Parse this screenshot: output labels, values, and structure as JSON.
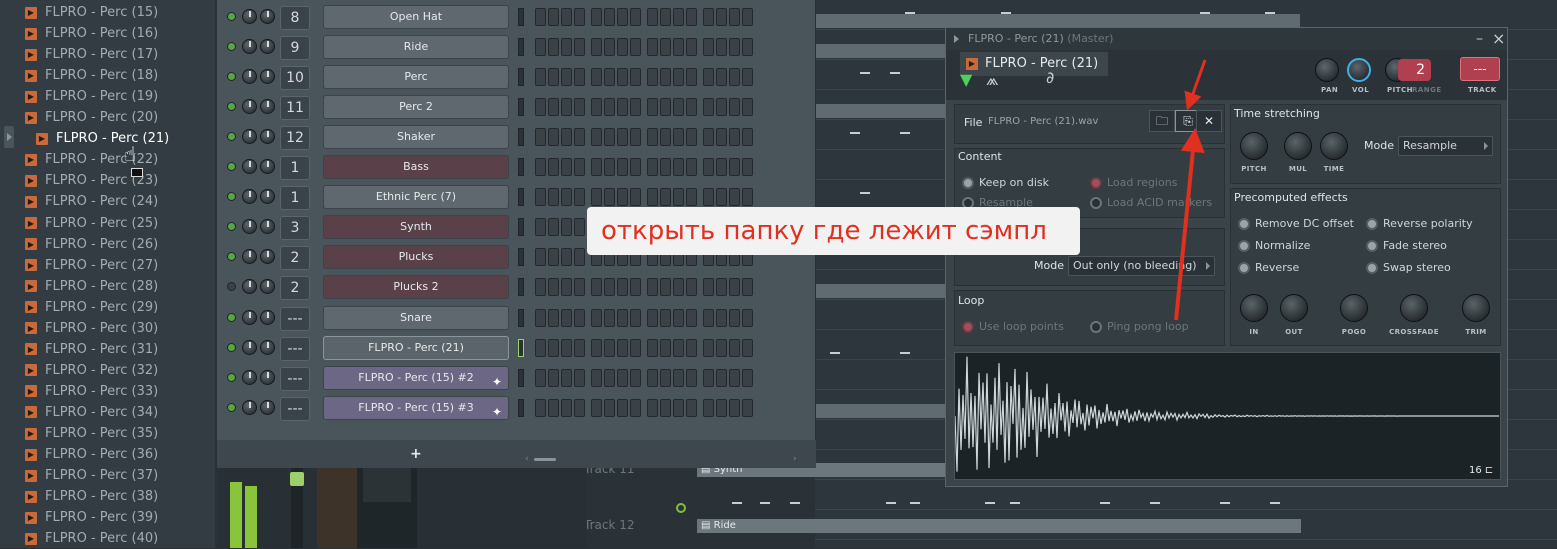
{
  "browser": {
    "items": [
      "FLPRO - Perc (15)",
      "FLPRO - Perc (16)",
      "FLPRO - Perc (17)",
      "FLPRO - Perc (18)",
      "FLPRO - Perc (19)",
      "FLPRO - Perc (20)",
      "FLPRO - Perc (21)",
      "FLPRO - Perc (22)",
      "FLPRO - Perc (23)",
      "FLPRO - Perc (24)",
      "FLPRO - Perc (25)",
      "FLPRO - Perc (26)",
      "FLPRO - Perc (27)",
      "FLPRO - Perc (28)",
      "FLPRO - Perc (29)",
      "FLPRO - Perc (30)",
      "FLPRO - Perc (31)",
      "FLPRO - Perc (32)",
      "FLPRO - Perc (33)",
      "FLPRO - Perc (34)",
      "FLPRO - Perc (35)",
      "FLPRO - Perc (36)",
      "FLPRO - Perc (37)",
      "FLPRO - Perc (38)",
      "FLPRO - Perc (39)",
      "FLPRO - Perc (40)"
    ],
    "selected_index": 6
  },
  "channel_rack": {
    "channels": [
      {
        "num": "8",
        "name": "Open Hat",
        "style": "grey",
        "led": "on"
      },
      {
        "num": "9",
        "name": "Ride",
        "style": "grey",
        "led": "on"
      },
      {
        "num": "10",
        "name": "Perc",
        "style": "grey",
        "led": "on"
      },
      {
        "num": "11",
        "name": "Perc 2",
        "style": "grey",
        "led": "on"
      },
      {
        "num": "12",
        "name": "Shaker",
        "style": "grey",
        "led": "on"
      },
      {
        "num": "1",
        "name": "Bass",
        "style": "red",
        "led": "on"
      },
      {
        "num": "1",
        "name": "Ethnic Perc (7)",
        "style": "grey",
        "led": "on"
      },
      {
        "num": "3",
        "name": "Synth",
        "style": "red",
        "led": "on"
      },
      {
        "num": "2",
        "name": "Plucks",
        "style": "red",
        "led": "on"
      },
      {
        "num": "2",
        "name": "Plucks 2",
        "style": "red",
        "led": "off"
      },
      {
        "num": "---",
        "name": "Snare",
        "style": "grey",
        "led": "on"
      },
      {
        "num": "---",
        "name": "FLPRO - Perc (21)",
        "style": "sel",
        "led": "on"
      },
      {
        "num": "---",
        "name": "FLPRO - Perc (15) #2",
        "style": "purple",
        "led": "on"
      },
      {
        "num": "---",
        "name": "FLPRO - Perc (15) #3",
        "style": "purple",
        "led": "on"
      }
    ],
    "add_label": "+"
  },
  "playlist": {
    "track_11_label": "Track 11",
    "track_12_label": "Track 12",
    "clip_synth": "Synth",
    "clip_ride": "Ride"
  },
  "sampler": {
    "title": "FLPRO - Perc (21)",
    "title_suffix": "(Master)",
    "channel_name": "FLPRO - Perc (21)",
    "minimize_label": "–",
    "close_label": "×",
    "header_knobs": {
      "pan": "PAN",
      "vol": "VOL",
      "pitch": "PITCH",
      "range": "RANGE",
      "track": "TRACK"
    },
    "range_value": "2",
    "track_value": "---",
    "file_label": "File",
    "file_name": "FLPRO - Perc (21).wav",
    "content_title": "Content",
    "keep_on_disk": "Keep on disk",
    "resample": "Resample",
    "load_regions": "Load regions",
    "load_acid": "Load ACID markers",
    "mode_label": "Mode",
    "mode_value": "Out only (no bleeding)",
    "loop_title": "Loop",
    "use_loop_points": "Use loop points",
    "ping_pong_loop": "Ping pong loop",
    "time_stretch_title": "Time stretching",
    "ts_pitch": "PITCH",
    "ts_mul": "MUL",
    "ts_time": "TIME",
    "ts_mode_label": "Mode",
    "ts_mode_value": "Resample",
    "precomputed_title": "Precomputed effects",
    "remove_dc": "Remove DC offset",
    "normalize": "Normalize",
    "reverse": "Reverse",
    "reverse_polarity": "Reverse polarity",
    "fade_stereo": "Fade stereo",
    "swap_stereo": "Swap stereo",
    "fx_knobs": [
      "IN",
      "OUT",
      "POGO",
      "CROSSFADE",
      "TRIM"
    ],
    "wave_count": "16"
  },
  "annotation": {
    "text": "открыть папку где лежит сэмпл",
    "color": "#e03020"
  }
}
